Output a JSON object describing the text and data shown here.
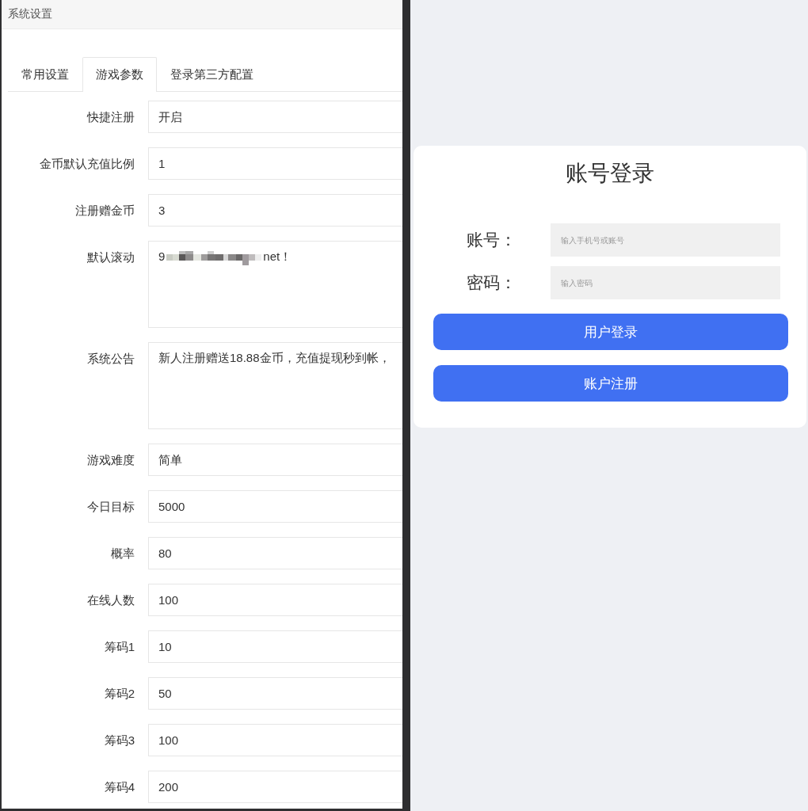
{
  "settings_panel": {
    "title": "系统设置",
    "tabs": [
      {
        "label": "常用设置",
        "selected": false
      },
      {
        "label": "游戏参数",
        "selected": true
      },
      {
        "label": "登录第三方配置",
        "selected": false
      }
    ],
    "fields": [
      {
        "label": "快捷注册",
        "kind": "input",
        "value": "开启"
      },
      {
        "label": "金币默认充值比例",
        "kind": "input",
        "value": "1"
      },
      {
        "label": "注册赠金币",
        "kind": "input",
        "value": "3"
      },
      {
        "label": "默认滚动",
        "kind": "textarea",
        "value": "9",
        "redacted": true,
        "value_after_redaction": "net！"
      },
      {
        "label": "系统公告",
        "kind": "textarea",
        "value": "新人注册赠送18.88金币，充值提现秒到帐，"
      },
      {
        "label": "游戏难度",
        "kind": "input",
        "value": "简单"
      },
      {
        "label": "今日目标",
        "kind": "input",
        "value": "5000"
      },
      {
        "label": "概率",
        "kind": "input",
        "value": "80"
      },
      {
        "label": "在线人数",
        "kind": "input",
        "value": "100"
      },
      {
        "label": "筹码1",
        "kind": "input",
        "value": "10"
      },
      {
        "label": "筹码2",
        "kind": "input",
        "value": "50"
      },
      {
        "label": "筹码3",
        "kind": "input",
        "value": "100"
      },
      {
        "label": "筹码4",
        "kind": "input",
        "value": "200"
      }
    ]
  },
  "login_panel": {
    "title": "账号登录",
    "fields": [
      {
        "label": "账号：",
        "placeholder": "输入手机号或账号"
      },
      {
        "label": "密码：",
        "placeholder": "输入密码"
      }
    ],
    "buttons": [
      "用户登录",
      "账户注册"
    ]
  }
}
